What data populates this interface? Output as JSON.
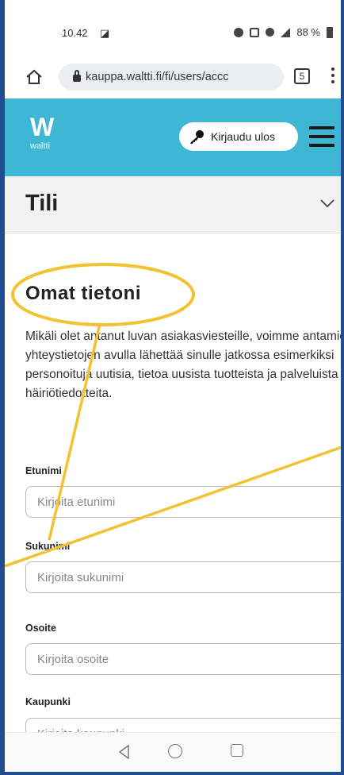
{
  "status_bar": {
    "time": "10.42",
    "battery": "88 %"
  },
  "browser": {
    "url": "kauppa.waltti.fi/fi/users/accc",
    "tab_count": "5"
  },
  "site": {
    "logo_letter": "W",
    "logo_text": "waltti",
    "logout_label": "Kirjaudu ulos"
  },
  "section": {
    "title": "Tili"
  },
  "content": {
    "heading": "Omat tietoni",
    "intro": "Mikäli olet antanut luvan asiakasviesteille, voimme antamiesi yhteystietojen avulla lähettää sinulle jatkossa esimerkiksi personoituja uutisia, tietoa uusista tuotteista ja palveluista tai häiriötiedotteita.",
    "fields": [
      {
        "label": "Etunimi",
        "placeholder": "Kirjoita etunimi"
      },
      {
        "label": "Sukunimi",
        "placeholder": "Kirjoita sukunimi"
      },
      {
        "label": "Osoite",
        "placeholder": "Kirjoita osoite"
      },
      {
        "label": "Kaupunki",
        "placeholder": "Kirjoita kaupunki"
      }
    ]
  },
  "colors": {
    "header_bg": "#3fb6d3",
    "annotation": "#f2c230",
    "frame": "#1f4d8f"
  },
  "icons": [
    "home-icon",
    "lock-icon",
    "tabs-icon",
    "more-icon",
    "key-icon",
    "hamburger-icon",
    "chevron-down-icon",
    "nav-back-icon",
    "nav-home-icon",
    "nav-recent-icon"
  ]
}
